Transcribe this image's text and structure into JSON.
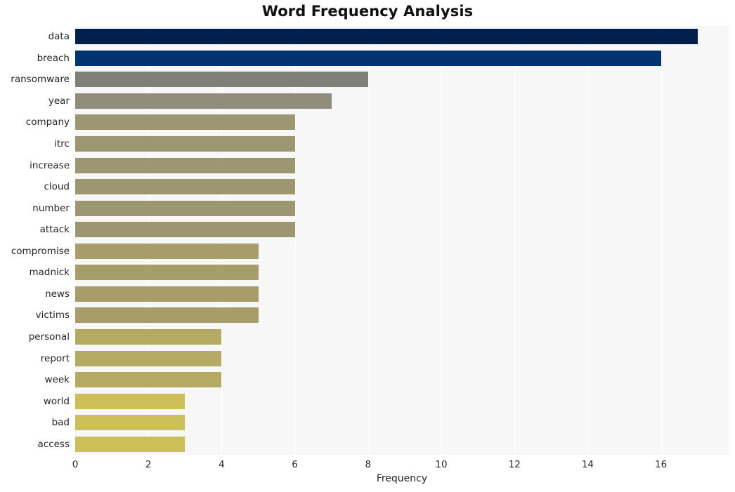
{
  "chart_data": {
    "type": "bar",
    "orientation": "horizontal",
    "title": "Word Frequency Analysis",
    "xlabel": "Frequency",
    "ylabel": "",
    "xlim": [
      0,
      17.85
    ],
    "xticks": [
      0,
      2,
      4,
      6,
      8,
      10,
      12,
      14,
      16
    ],
    "grid": "vertical-only",
    "legend": "none",
    "categories": [
      "data",
      "breach",
      "ransomware",
      "year",
      "company",
      "itrc",
      "increase",
      "cloud",
      "number",
      "attack",
      "compromise",
      "madnick",
      "news",
      "victims",
      "personal",
      "report",
      "week",
      "world",
      "bad",
      "access"
    ],
    "values": [
      17,
      16,
      8,
      7,
      6,
      6,
      6,
      6,
      6,
      6,
      5,
      5,
      5,
      5,
      4,
      4,
      4,
      3,
      3,
      3
    ],
    "bar_colors": [
      "#00214d",
      "#003370",
      "#80807b",
      "#918d7c",
      "#9c9771",
      "#9c9771",
      "#9c9771",
      "#9c9771",
      "#9c9771",
      "#9c9771",
      "#a79d6b",
      "#a79d6b",
      "#a79d6b",
      "#a79d6b",
      "#b5aa63",
      "#b5aa63",
      "#b5aa63",
      "#ccbf57",
      "#ccbf57",
      "#ccbf57"
    ]
  },
  "style": {
    "plot_background": "#f7f7f7",
    "figure_background": "#ffffff",
    "gridline_color": "#ffffff",
    "text_color": "#262626"
  }
}
